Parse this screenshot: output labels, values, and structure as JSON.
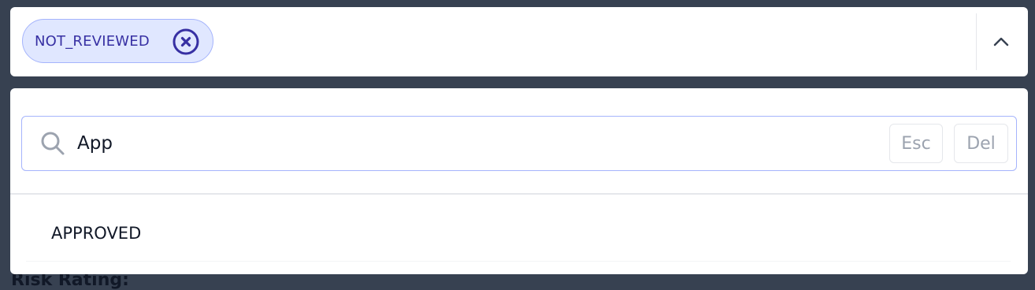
{
  "field_label_behind": "Risk Rating:",
  "select": {
    "selected_chips": [
      {
        "label": "NOT_REVIEWED",
        "remove_icon": "x-circle-icon"
      }
    ],
    "toggle_icon": "chevron-up-icon"
  },
  "dropdown": {
    "search": {
      "icon": "search-icon",
      "value": "App",
      "esc_label": "Esc",
      "del_label": "Del"
    },
    "options": [
      {
        "label": "APPROVED"
      }
    ]
  },
  "colors": {
    "backdrop": "#374151",
    "chip_bg": "#e0e7ff",
    "chip_border": "#a5b4fc",
    "chip_text": "#3730a3",
    "accent_border": "#a5b4fc"
  }
}
